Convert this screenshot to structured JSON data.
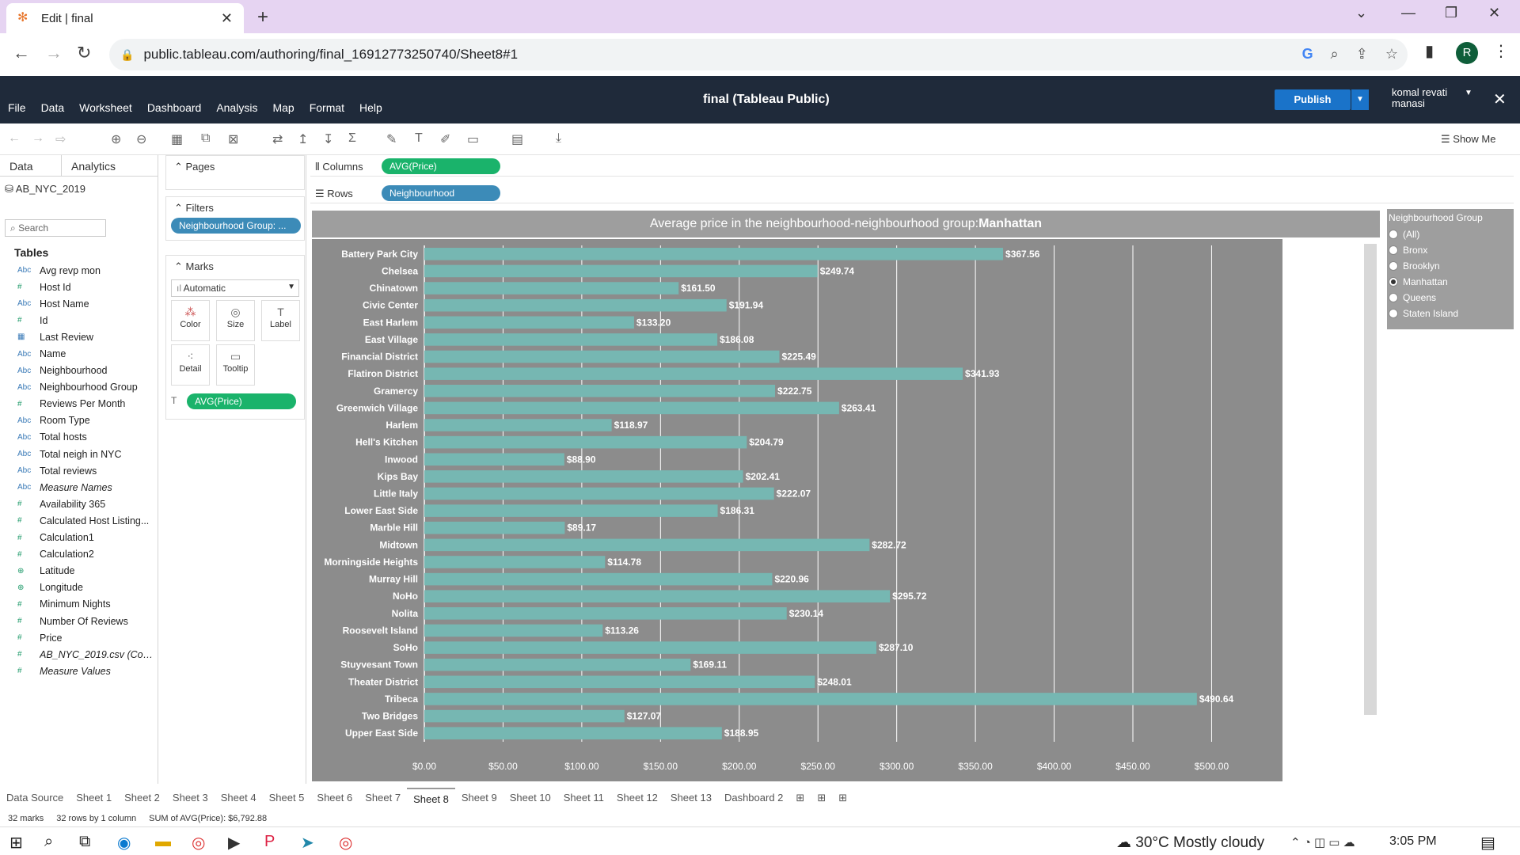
{
  "browser": {
    "tab_title": "Edit | final",
    "url": "public.tableau.com/authoring/final_16912773250740/Sheet8#1",
    "profile_initial": "R"
  },
  "tableau": {
    "menu": [
      "File",
      "Data",
      "Worksheet",
      "Dashboard",
      "Analysis",
      "Map",
      "Format",
      "Help"
    ],
    "app_title": "final (Tableau Public)",
    "publish_label": "Publish",
    "user_name_line1": "komal revati",
    "user_name_line2": "manasi",
    "show_me": "Show Me"
  },
  "data_pane": {
    "tab_data": "Data",
    "tab_analytics": "Analytics",
    "datasource": "AB_NYC_2019",
    "search_placeholder": "Search",
    "tables_heading": "Tables",
    "fields": [
      {
        "type": "Abc",
        "name": "Avg revp mon",
        "kind": "dim"
      },
      {
        "type": "#",
        "name": "Host Id",
        "kind": "meas"
      },
      {
        "type": "Abc",
        "name": "Host Name",
        "kind": "dim"
      },
      {
        "type": "#",
        "name": "Id",
        "kind": "meas"
      },
      {
        "type": "▦",
        "name": "Last Review",
        "kind": "dim"
      },
      {
        "type": "Abc",
        "name": "Name",
        "kind": "dim"
      },
      {
        "type": "Abc",
        "name": "Neighbourhood",
        "kind": "dim"
      },
      {
        "type": "Abc",
        "name": "Neighbourhood Group",
        "kind": "dim"
      },
      {
        "type": "#",
        "name": "Reviews Per Month",
        "kind": "meas"
      },
      {
        "type": "Abc",
        "name": "Room Type",
        "kind": "dim"
      },
      {
        "type": "Abc",
        "name": "Total hosts",
        "kind": "dim"
      },
      {
        "type": "Abc",
        "name": "Total neigh in NYC",
        "kind": "dim"
      },
      {
        "type": "Abc",
        "name": "Total reviews",
        "kind": "dim"
      },
      {
        "type": "Abc",
        "name": "Measure Names",
        "kind": "dim",
        "italic": true
      },
      {
        "type": "#",
        "name": "Availability 365",
        "kind": "meas"
      },
      {
        "type": "#",
        "name": "Calculated Host Listing...",
        "kind": "meas"
      },
      {
        "type": "#",
        "name": "Calculation1",
        "kind": "meas"
      },
      {
        "type": "#",
        "name": "Calculation2",
        "kind": "meas"
      },
      {
        "type": "⊕",
        "name": "Latitude",
        "kind": "meas"
      },
      {
        "type": "⊕",
        "name": "Longitude",
        "kind": "meas"
      },
      {
        "type": "#",
        "name": "Minimum Nights",
        "kind": "meas"
      },
      {
        "type": "#",
        "name": "Number Of Reviews",
        "kind": "meas"
      },
      {
        "type": "#",
        "name": "Price",
        "kind": "meas"
      },
      {
        "type": "#",
        "name": "AB_NYC_2019.csv (Cou...",
        "kind": "meas",
        "italic": true
      },
      {
        "type": "#",
        "name": "Measure Values",
        "kind": "meas",
        "italic": true
      }
    ]
  },
  "cards": {
    "pages": "Pages",
    "filters": "Filters",
    "filter_pill": "Neighbourhood Group: ...",
    "marks": "Marks",
    "mark_type": "Automatic",
    "mark_buttons": [
      "Color",
      "Size",
      "Label",
      "Detail",
      "Tooltip"
    ],
    "label_pill": "AVG(Price)"
  },
  "shelves": {
    "columns_label": "Columns",
    "columns_pill": "AVG(Price)",
    "rows_label": "Rows",
    "rows_pill": "Neighbourhood"
  },
  "viz_title_prefix": "Average price in the neighbourhood-neighbourhood group:",
  "viz_title_bold": "Manhattan",
  "legend": {
    "title": "Neighbourhood Group",
    "options": [
      "(All)",
      "Bronx",
      "Brooklyn",
      "Manhattan",
      "Queens",
      "Staten Island"
    ],
    "selected": "Manhattan"
  },
  "chart_data": {
    "type": "bar",
    "orientation": "horizontal",
    "title": "Average price in the neighbourhood-neighbourhood group:Manhattan",
    "categories": [
      "Battery Park City",
      "Chelsea",
      "Chinatown",
      "Civic Center",
      "East Harlem",
      "East Village",
      "Financial District",
      "Flatiron District",
      "Gramercy",
      "Greenwich Village",
      "Harlem",
      "Hell's Kitchen",
      "Inwood",
      "Kips Bay",
      "Little Italy",
      "Lower East Side",
      "Marble Hill",
      "Midtown",
      "Morningside Heights",
      "Murray Hill",
      "NoHo",
      "Nolita",
      "Roosevelt Island",
      "SoHo",
      "Stuyvesant Town",
      "Theater District",
      "Tribeca",
      "Two Bridges",
      "Upper East Side"
    ],
    "values": [
      367.56,
      249.74,
      161.5,
      191.94,
      133.2,
      186.08,
      225.49,
      341.93,
      222.75,
      263.41,
      118.97,
      204.79,
      88.9,
      202.41,
      222.07,
      186.31,
      89.17,
      282.72,
      114.78,
      220.96,
      295.72,
      230.14,
      113.26,
      287.1,
      169.11,
      248.01,
      490.64,
      127.07,
      188.95
    ],
    "labels": [
      "$367.56",
      "$249.74",
      "$161.50",
      "$191.94",
      "$133.20",
      "$186.08",
      "$225.49",
      "$341.93",
      "$222.75",
      "$263.41",
      "$118.97",
      "$204.79",
      "$88.90",
      "$202.41",
      "$222.07",
      "$186.31",
      "$89.17",
      "$282.72",
      "$114.78",
      "$220.96",
      "$295.72",
      "$230.14",
      "$113.26",
      "$287.10",
      "$169.11",
      "$248.01",
      "$490.64",
      "$127.07",
      "$188.95"
    ],
    "x_ticks": [
      "$0.00",
      "$50.00",
      "$100.00",
      "$150.00",
      "$200.00",
      "$250.00",
      "$300.00",
      "$350.00",
      "$400.00",
      "$450.00",
      "$500.00"
    ],
    "xlim": [
      0,
      540
    ],
    "bar_color": "#76b7b2",
    "background": "#8c8c8c",
    "grid": true
  },
  "sheets": [
    "Data Source",
    "Sheet 1",
    "Sheet 2",
    "Sheet 3",
    "Sheet 4",
    "Sheet 5",
    "Sheet 6",
    "Sheet 7",
    "Sheet 8",
    "Sheet 9",
    "Sheet 10",
    "Sheet 11",
    "Sheet 12",
    "Sheet 13",
    "Dashboard 2"
  ],
  "active_sheet": "Sheet 8",
  "status": {
    "marks": "32 marks",
    "rows": "32 rows by 1 column",
    "sum": "SUM of AVG(Price): $6,792.88"
  },
  "taskbar": {
    "weather": "30°C  Mostly cloudy",
    "time": "3:05 PM"
  }
}
